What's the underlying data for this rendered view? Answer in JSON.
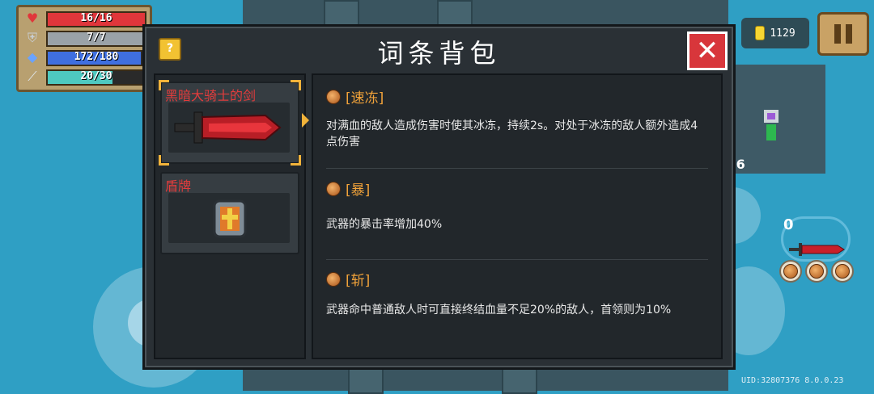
{
  "hud": {
    "hp": "16/16",
    "armor": "7/7",
    "energy": "172/180",
    "skill": "20/30",
    "hp_fraction": 1.0,
    "armor_fraction": 1.0,
    "energy_fraction": 0.956,
    "skill_fraction": 0.667,
    "coins": "1129"
  },
  "dialog": {
    "title": "词条背包",
    "help_label": "?",
    "close_label": "✕"
  },
  "items": [
    {
      "name": "黑暗大骑士的剑",
      "selected": true
    },
    {
      "name": "盾牌",
      "selected": false
    }
  ],
  "traits": [
    {
      "name": "[速冻]",
      "desc": "对满血的敌人造成伤害时使其冰冻，持续2s。对处于冰冻的敌人额外造成4点伤害"
    },
    {
      "name": "[暴]",
      "desc": "武器的暴击率增加40%"
    },
    {
      "name": "[斩]",
      "desc": "武器命中普通敌人时可直接终结血量不足20%的敌人，首领则为10%"
    }
  ],
  "scene": {
    "hp_change": "-6",
    "weapon_ammo": "0",
    "uid": "UID:32807376 8.0.0.23"
  },
  "colors": {
    "hp": "#e0363b",
    "armor": "#9aa2a8",
    "energy": "#3f6fe0",
    "skill": "#4ec9c0",
    "trait_name": "#f2a33a",
    "item_name": "#e23c3c"
  }
}
